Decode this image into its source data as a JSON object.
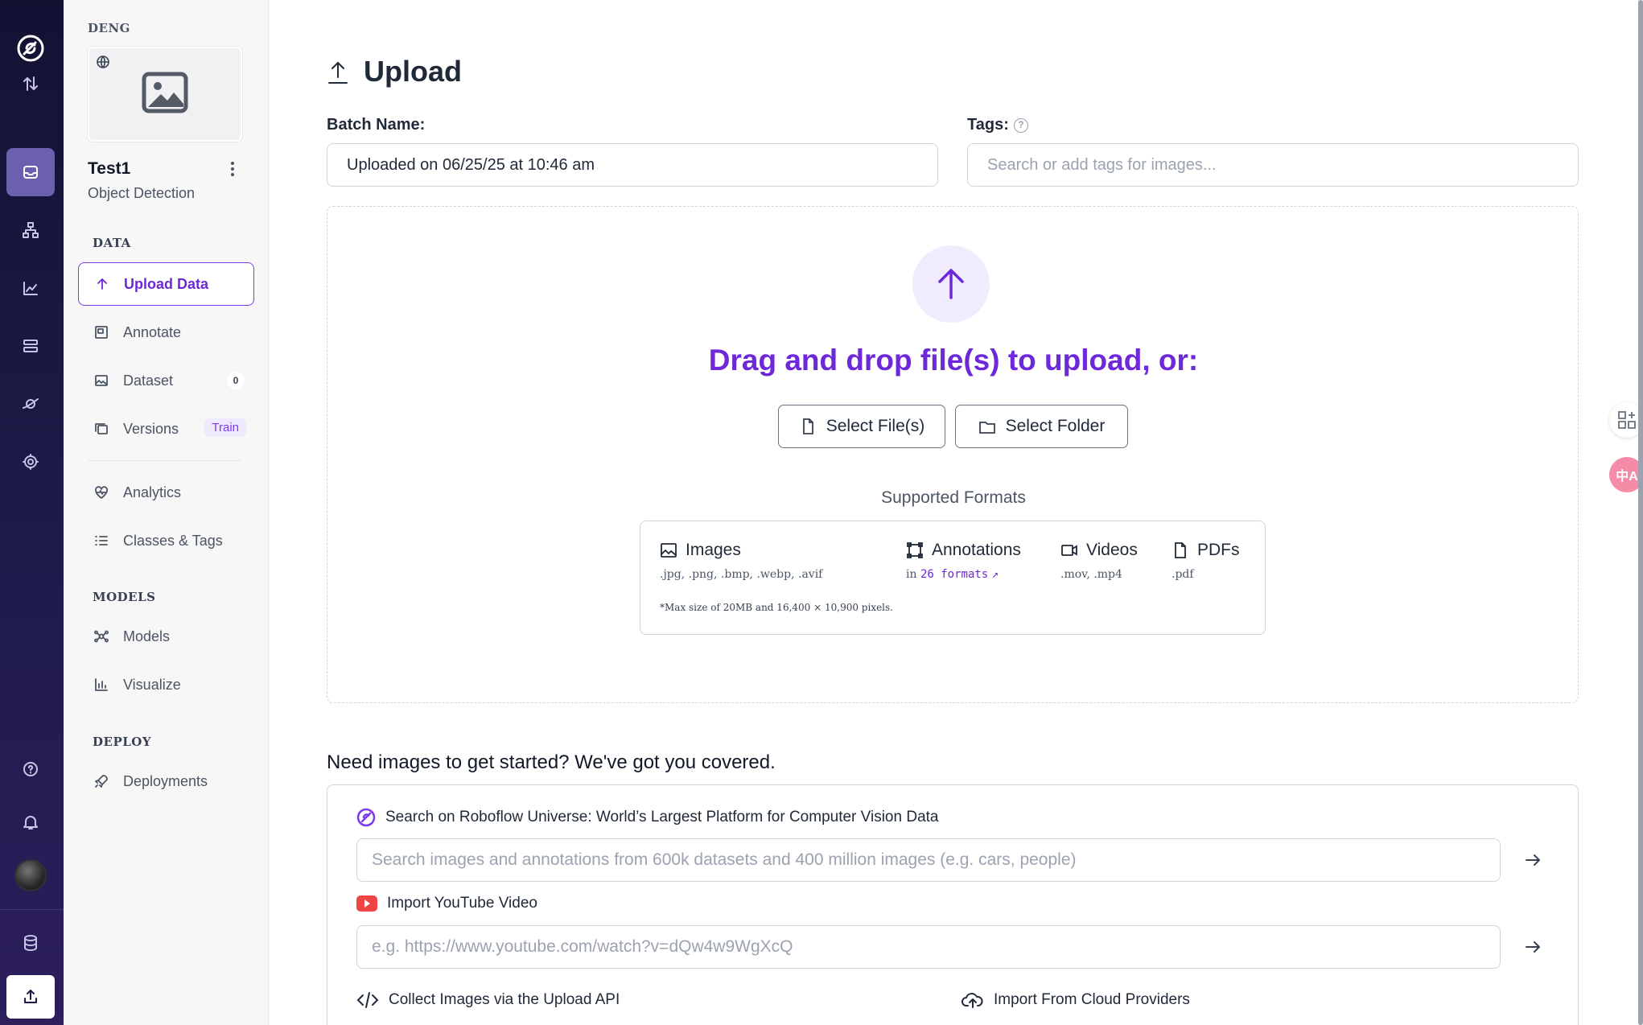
{
  "rail": {
    "items": [
      "logo-icon",
      "swap-icon",
      "inbox-icon",
      "workflow-icon",
      "chart-icon",
      "stack-icon",
      "universe-icon",
      "gear-icon",
      "help-icon",
      "bell-icon",
      "avatar",
      "database-icon",
      "upload-icon"
    ]
  },
  "sidebar": {
    "workspace": "DENG",
    "project_name": "Test1",
    "project_type": "Object Detection",
    "sections": {
      "data": "DATA",
      "models": "MODELS",
      "deploy": "DEPLOY"
    },
    "items": {
      "upload": "Upload Data",
      "annotate": "Annotate",
      "dataset": "Dataset",
      "dataset_count": "0",
      "versions": "Versions",
      "versions_badge": "Train",
      "analytics": "Analytics",
      "classes": "Classes & Tags",
      "models": "Models",
      "visualize": "Visualize",
      "deployments": "Deployments"
    }
  },
  "main": {
    "title": "Upload",
    "batch_label": "Batch Name:",
    "batch_value": "Uploaded on 06/25/25 at 10:46 am",
    "tags_label": "Tags:",
    "tags_placeholder": "Search or add tags for images...",
    "dropzone": {
      "title": "Drag and drop file(s) to upload, or:",
      "select_files": "Select File(s)",
      "select_folder": "Select Folder",
      "supported_label": "Supported Formats",
      "images": {
        "label": "Images",
        "formats": ".jpg, .png, .bmp, .webp, .avif"
      },
      "annotations": {
        "label": "Annotations",
        "prefix": "in",
        "link": "26 formats"
      },
      "videos": {
        "label": "Videos",
        "formats": ".mov, .mp4"
      },
      "pdfs": {
        "label": "PDFs",
        "formats": ".pdf"
      },
      "note": "*Max size of 20MB and 16,400 × 10,900 pixels."
    },
    "need_images": "Need images to get started? We've got you covered.",
    "universe": {
      "label": "Search on Roboflow Universe: World’s Largest Platform for Computer Vision Data",
      "placeholder": "Search images and annotations from 600k datasets and 400 million images (e.g. cars, people)"
    },
    "youtube": {
      "label": "Import YouTube Video",
      "placeholder": "e.g. https://www.youtube.com/watch?v=dQw4w9WgXcQ"
    },
    "upload_api": "Collect Images via the Upload API",
    "cloud": "Import From Cloud Providers"
  },
  "floating": {
    "translate": "中A"
  },
  "colors": {
    "accent": "#6d28d9",
    "rail_bg": "#1e1b4b",
    "youtube_red": "#ef4444"
  }
}
